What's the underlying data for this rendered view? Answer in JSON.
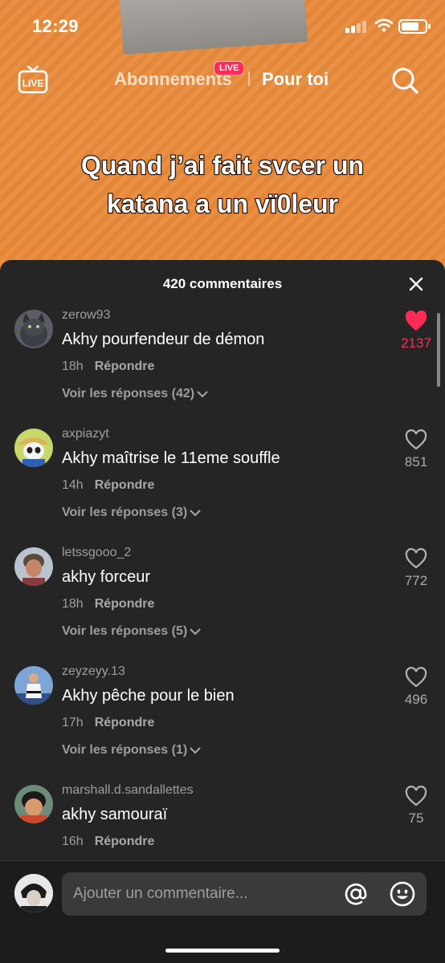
{
  "status_bar": {
    "time": "12:29",
    "battery_level": 0.75
  },
  "top_nav": {
    "tab_following": "Abonnements",
    "live_badge": "LIVE",
    "live_icon_label": "LIVE",
    "tab_for_you": "Pour toi",
    "active_tab": "Pour toi"
  },
  "video": {
    "caption_lines": [
      "Quand j’ai fait svcer un",
      "katana a un vï0leur"
    ]
  },
  "comments_panel": {
    "title": "420 commentaires",
    "comments": [
      {
        "username": "zerow93",
        "text": "Akhy pourfendeur de démon",
        "time": "18h",
        "reply_label": "Répondre",
        "view_replies": "Voir les réponses (42)",
        "likes": "2137",
        "liked": true,
        "avatar_icon": "cat-avatar"
      },
      {
        "username": "axpiazyt",
        "text": "Akhy maîtrise le 11eme souffle",
        "time": "14h",
        "reply_label": "Répondre",
        "view_replies": "Voir les réponses (3)",
        "likes": "851",
        "liked": false,
        "avatar_icon": "panda-avatar"
      },
      {
        "username": "letssgooo_2",
        "text": "akhy forceur",
        "time": "18h",
        "reply_label": "Répondre",
        "view_replies": "Voir les réponses (5)",
        "likes": "772",
        "liked": false,
        "avatar_icon": "person-avatar"
      },
      {
        "username": "zeyzeyy.13",
        "text": "Akhy pêche pour le bien",
        "time": "17h",
        "reply_label": "Répondre",
        "view_replies": "Voir les réponses (1)",
        "likes": "496",
        "liked": false,
        "avatar_icon": "judo-avatar"
      },
      {
        "username": "marshall.d.sandallettes",
        "text": "akhy samouraï",
        "time": "16h",
        "reply_label": "Répondre",
        "view_replies": "",
        "likes": "75",
        "liked": false,
        "avatar_icon": "anime-avatar"
      }
    ]
  },
  "input_bar": {
    "placeholder": "Ajouter un commentaire..."
  },
  "colors": {
    "accent": "#fe2c55",
    "sheet_bg": "#252525",
    "video_bg": "#e88a3c"
  }
}
